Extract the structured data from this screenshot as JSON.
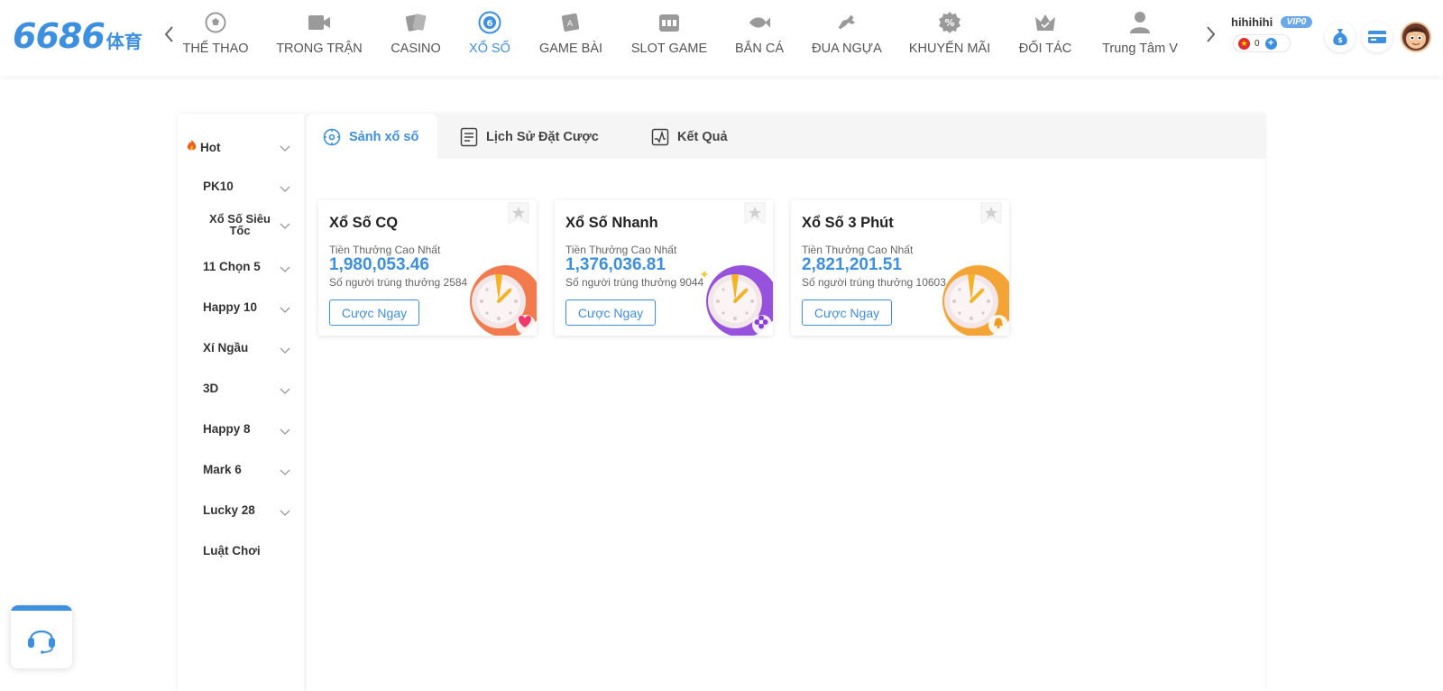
{
  "logo": {
    "number": "6686",
    "suffix": "体育"
  },
  "nav": {
    "prev_icon": "chevron-left-icon",
    "next_icon": "chevron-right-icon",
    "items": [
      {
        "label": "THỂ THAO",
        "icon": "soccer-ball-icon",
        "active": false
      },
      {
        "label": "TRONG TRẬN",
        "icon": "video-camera-icon",
        "active": false
      },
      {
        "label": "CASINO",
        "icon": "cards-icon",
        "active": false
      },
      {
        "label": "XỔ SỐ",
        "icon": "lottery-ball-icon",
        "active": true
      },
      {
        "label": "GAME BÀI",
        "icon": "card-game-icon",
        "active": false
      },
      {
        "label": "SLOT GAME",
        "icon": "slot-machine-icon",
        "active": false
      },
      {
        "label": "BẮN CÁ",
        "icon": "fish-icon",
        "active": false
      },
      {
        "label": "ĐUA NGỰA",
        "icon": "horse-icon",
        "active": false
      },
      {
        "label": "KHUYẾN MÃI",
        "icon": "discount-icon",
        "active": false
      },
      {
        "label": "ĐỐI TÁC",
        "icon": "crown-icon",
        "active": false
      },
      {
        "label": "Trung Tâm V",
        "icon": "user-icon",
        "active": false
      }
    ]
  },
  "user": {
    "name": "hihihihi",
    "vip": "VIP0",
    "balance": "0",
    "actions": [
      "money-bag-icon",
      "card-icon"
    ]
  },
  "sidebar": {
    "items": [
      {
        "label": "Hot",
        "icon": "flame-icon",
        "expandable": true
      },
      {
        "label": "PK10",
        "expandable": true
      },
      {
        "label": "Xổ Số Siêu Tốc",
        "expandable": true
      },
      {
        "label": "11 Chọn 5",
        "expandable": true
      },
      {
        "label": "Happy 10",
        "expandable": true
      },
      {
        "label": "Xí Ngầu",
        "expandable": true
      },
      {
        "label": "3D",
        "expandable": true
      },
      {
        "label": "Happy 8",
        "expandable": true
      },
      {
        "label": "Mark 6",
        "expandable": true
      },
      {
        "label": "Lucky 28",
        "expandable": true
      },
      {
        "label": "Luật Chơi",
        "expandable": false
      }
    ]
  },
  "tabs": [
    {
      "label": "Sảnh xổ số",
      "icon": "target-icon",
      "active": true
    },
    {
      "label": "Lịch Sử Đặt Cược",
      "icon": "document-icon",
      "active": false
    },
    {
      "label": "Kết Quả",
      "icon": "chart-icon",
      "active": false
    }
  ],
  "cards": [
    {
      "title": "Xổ Số CQ",
      "subtitle": "Tiền Thưởng Cao Nhất",
      "amount": "1,980,053.46",
      "winners": "Số người trúng thưởng 2584",
      "button": "Cược Ngay",
      "theme": "#f26b3a",
      "badge": "heart-icon"
    },
    {
      "title": "Xổ Số Nhanh",
      "subtitle": "Tiền Thưởng Cao Nhất",
      "amount": "1,376,036.81",
      "winners": "Số người trúng thưởng 9044",
      "button": "Cược Ngay",
      "theme": "#8b3fd9",
      "badge": "flower-icon"
    },
    {
      "title": "Xổ Số 3 Phút",
      "subtitle": "Tiền Thưởng Cao Nhất",
      "amount": "2,821,201.51",
      "winners": "Số người trúng thưởng 10603",
      "button": "Cược Ngay",
      "theme": "#f39a1e",
      "badge": "bell-icon"
    }
  ],
  "support": {
    "icon": "headset-icon"
  },
  "colors": {
    "accent": "#3d8fe0",
    "text": "#333333",
    "muted": "#666666"
  }
}
